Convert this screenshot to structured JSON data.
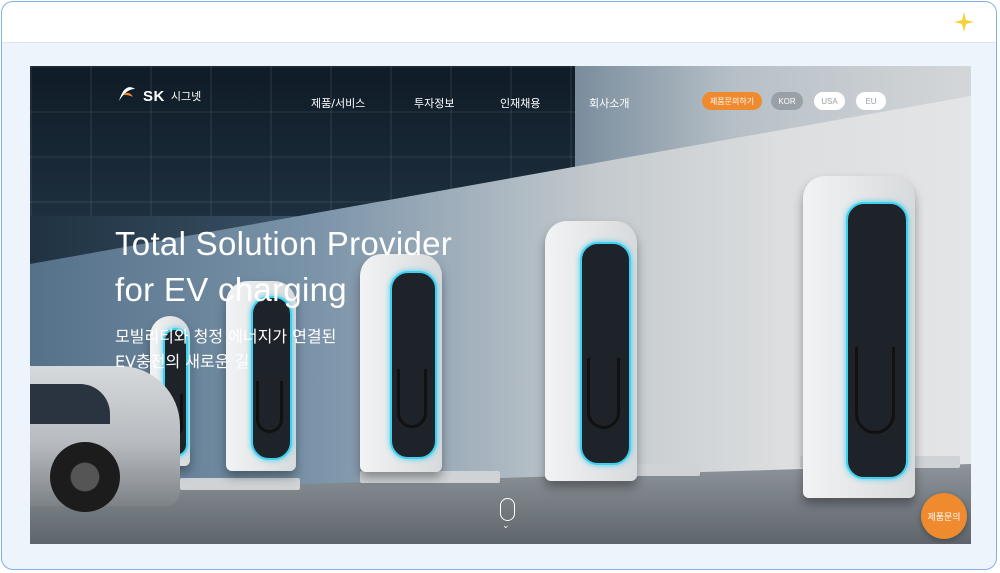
{
  "brand": {
    "mark": "SK",
    "name": "시그넷"
  },
  "nav": {
    "items": [
      "제품/서비스",
      "투자정보",
      "인재채용",
      "회사소개"
    ],
    "inquiry_button": "제품문의하기",
    "languages": [
      "KOR",
      "USA",
      "EU"
    ],
    "selected_language": "KOR"
  },
  "hero": {
    "title_line1": "Total Solution Provider",
    "title_line2": "for EV charging",
    "subtitle_line1": "모빌리티와 청정 에너지가 연결된",
    "subtitle_line2": "EV충전의 새로운 길"
  },
  "floating_button": "제품문의",
  "colors": {
    "accent_orange": "#f08a2e",
    "frame_border": "#7fb0e8",
    "charger_glow": "#3fd0f0"
  },
  "icons": [
    "sparkle-icon",
    "sk-logo-icon",
    "scroll-mouse-icon",
    "chevron-down-icon"
  ]
}
